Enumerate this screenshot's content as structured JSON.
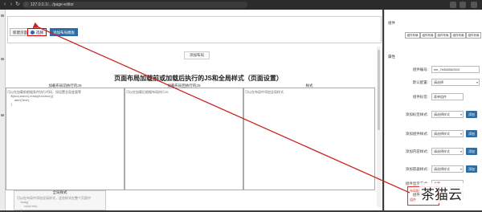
{
  "browser": {
    "url": "127.0.0.1/…/page-editor",
    "lock_icon": "info-icon"
  },
  "toolbar": {
    "btn_first": "新建页面",
    "btn_selected": "选择",
    "btn_add": "添加布局模板"
  },
  "main": {
    "add_layout": "添加布局",
    "title": "页面布局加载前或加载后执行的JS和全局样式（页面设置）",
    "columns": [
      {
        "header": "加载布局前执行的JS",
        "text": "可以在加载前根据条件执行代码，如设置全局变量等\n    $(document).ready(function(){\n        alert('test');\n    }"
      },
      {
        "header": "加载布局后执行的JS",
        "text": "可以在加载后根据布局执行JS"
      },
      {
        "header": "样式",
        "text": "可以在布局中添加全局样式"
      }
    ],
    "bottom": {
      "header": "全局样式",
      "text": "可以在布局中添加全局样式，这些样式在整个页面中\n    body{\n        color:red;\n    }"
    }
  },
  "panel": {
    "section1": "组件",
    "tabs": [
      "组件布局",
      "组件布局",
      "组件布局",
      "组件布局",
      "组件布局"
    ],
    "section2": "属性",
    "rows": [
      {
        "label": "组件编号:",
        "value": "ele_76366562504"
      },
      {
        "label": "默认配置:",
        "value": "请选择"
      },
      {
        "label": "组件标签:",
        "value": "表单组件"
      },
      {
        "label": "添加标签样式:",
        "value": "请选择样式",
        "button": "添加"
      },
      {
        "label": "添加组件样式:",
        "value": "请选择样式",
        "button": "添加"
      },
      {
        "label": "添加内容样式:",
        "value": "请选择样式",
        "button": "添加"
      },
      {
        "label": "添加容器样式:",
        "value": "请选择样式",
        "button": "添加"
      },
      {
        "label": "组件显示方式:",
        "value": "总是"
      },
      {
        "label": "组件宽度:",
        "value": "1"
      }
    ],
    "redbox_lines": [
      "布局配置",
      "组件"
    ]
  },
  "watermark": "茶猫云",
  "colors": {
    "accent": "#2e6da4",
    "arrow": "#cc2222"
  }
}
